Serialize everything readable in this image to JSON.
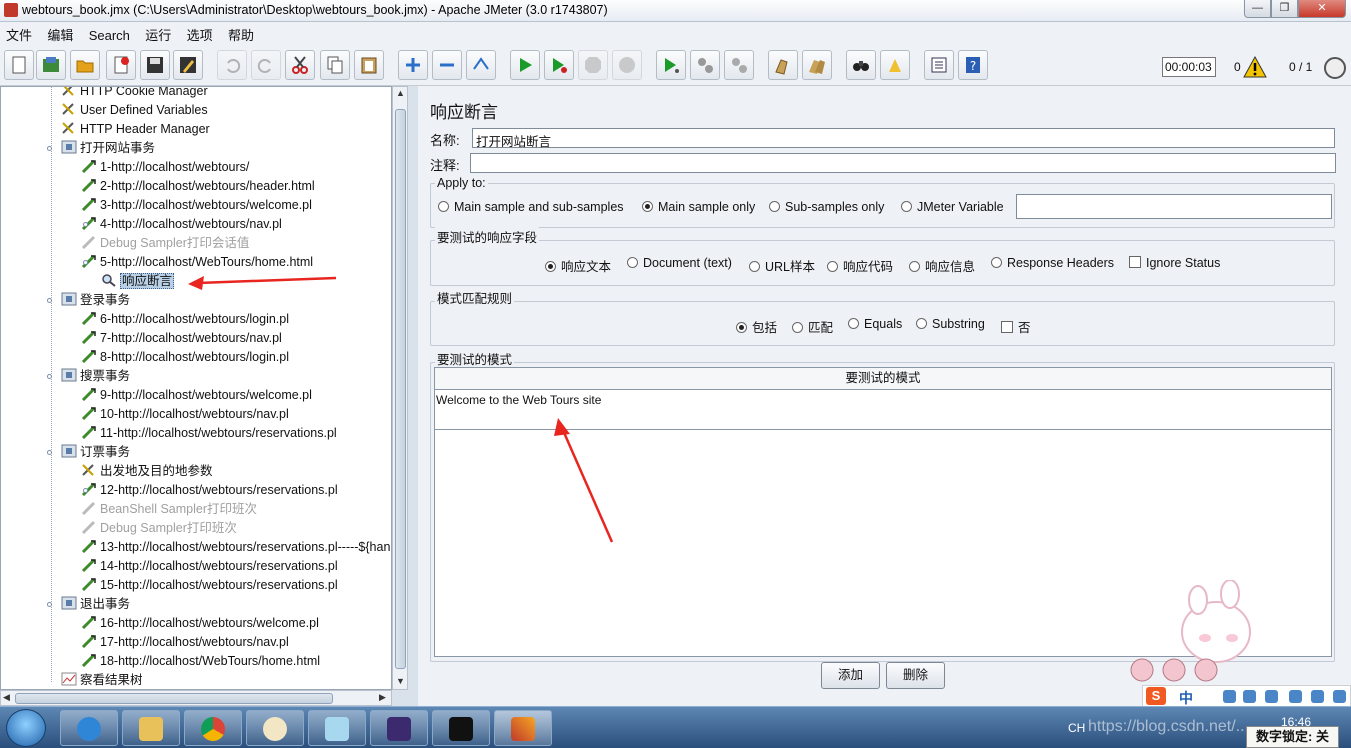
{
  "window": {
    "title": "webtours_book.jmx (C:\\Users\\Administrator\\Desktop\\webtours_book.jmx) - Apache JMeter (3.0 r1743807)"
  },
  "menu": [
    "文件",
    "编辑",
    "Search",
    "运行",
    "选项",
    "帮助"
  ],
  "toolbar": {
    "timer": "00:00:03",
    "error_count": "0",
    "thread_ratio": "0 / 1"
  },
  "tree": {
    "items": [
      {
        "label": "HTTP Cookie Manager",
        "icon": "tools-icon"
      },
      {
        "label": "User Defined Variables",
        "icon": "tools-icon"
      },
      {
        "label": "HTTP Header Manager",
        "icon": "tools-icon"
      },
      {
        "label": "打开网站事务",
        "icon": "controller-icon"
      },
      {
        "label": "1-http://localhost/webtours/",
        "icon": "sampler-icon"
      },
      {
        "label": "2-http://localhost/webtours/header.html",
        "icon": "sampler-icon"
      },
      {
        "label": "3-http://localhost/webtours/welcome.pl",
        "icon": "sampler-icon"
      },
      {
        "label": "4-http://localhost/webtours/nav.pl",
        "icon": "sampler-icon"
      },
      {
        "label": "Debug Sampler打印会话值",
        "icon": "sampler-icon"
      },
      {
        "label": "5-http://localhost/WebTours/home.html",
        "icon": "sampler-icon"
      },
      {
        "label": "响应断言",
        "icon": "magnifier-icon"
      },
      {
        "label": "登录事务",
        "icon": "controller-icon"
      },
      {
        "label": "6-http://localhost/webtours/login.pl",
        "icon": "sampler-icon"
      },
      {
        "label": "7-http://localhost/webtours/nav.pl",
        "icon": "sampler-icon"
      },
      {
        "label": "8-http://localhost/webtours/login.pl",
        "icon": "sampler-icon"
      },
      {
        "label": "搜票事务",
        "icon": "controller-icon"
      },
      {
        "label": "9-http://localhost/webtours/welcome.pl",
        "icon": "sampler-icon"
      },
      {
        "label": "10-http://localhost/webtours/nav.pl",
        "icon": "sampler-icon"
      },
      {
        "label": "11-http://localhost/webtours/reservations.pl",
        "icon": "sampler-icon"
      },
      {
        "label": "订票事务",
        "icon": "controller-icon"
      },
      {
        "label": "出发地及目的地参数",
        "icon": "tools-icon"
      },
      {
        "label": "12-http://localhost/webtours/reservations.pl",
        "icon": "sampler-icon"
      },
      {
        "label": "BeanShell Sampler打印班次",
        "icon": "sampler-icon"
      },
      {
        "label": "Debug Sampler打印班次",
        "icon": "sampler-icon"
      },
      {
        "label": "13-http://localhost/webtours/reservations.pl-----${han",
        "icon": "sampler-icon"
      },
      {
        "label": "14-http://localhost/webtours/reservations.pl",
        "icon": "sampler-icon"
      },
      {
        "label": "15-http://localhost/webtours/reservations.pl",
        "icon": "sampler-icon"
      },
      {
        "label": "退出事务",
        "icon": "controller-icon"
      },
      {
        "label": "16-http://localhost/webtours/welcome.pl",
        "icon": "sampler-icon"
      },
      {
        "label": "17-http://localhost/webtours/nav.pl",
        "icon": "sampler-icon"
      },
      {
        "label": "18-http://localhost/WebTours/home.html",
        "icon": "sampler-icon"
      },
      {
        "label": "察看结果树",
        "icon": "chart-icon"
      }
    ]
  },
  "panel": {
    "title": "响应断言",
    "name_label": "名称:",
    "name_value": "打开网站断言",
    "comment_label": "注释:",
    "comment_value": "",
    "apply_to": {
      "title": "Apply to:",
      "options": [
        "Main sample and sub-samples",
        "Main sample only",
        "Sub-samples only",
        "JMeter Variable"
      ],
      "selected": "Main sample only",
      "variable_value": ""
    },
    "response_field": {
      "title": "要测试的响应字段",
      "options": [
        "响应文本",
        "Document (text)",
        "URL样本",
        "响应代码",
        "响应信息",
        "Response Headers"
      ],
      "selected": "响应文本",
      "ignore_status": "Ignore Status"
    },
    "matching_rules": {
      "title": "模式匹配规则",
      "options": [
        "包括",
        "匹配",
        "Equals",
        "Substring"
      ],
      "selected": "包括",
      "not_label": "否"
    },
    "patterns": {
      "title": "要测试的模式",
      "column": "要测试的模式",
      "rows": [
        "Welcome to the Web Tours site"
      ]
    },
    "add_button": "添加",
    "delete_button": "删除"
  },
  "taskbar": {
    "lang": "CH",
    "clock": "16:46",
    "numlock": "数字锁定: 关",
    "ime_text": "中",
    "watermark": "https://blog.csdn.net/..."
  },
  "colors": {
    "selection": "#b8cfe5",
    "annotation_arrow": "#e8261f",
    "start_green": "#1a9b2a"
  }
}
